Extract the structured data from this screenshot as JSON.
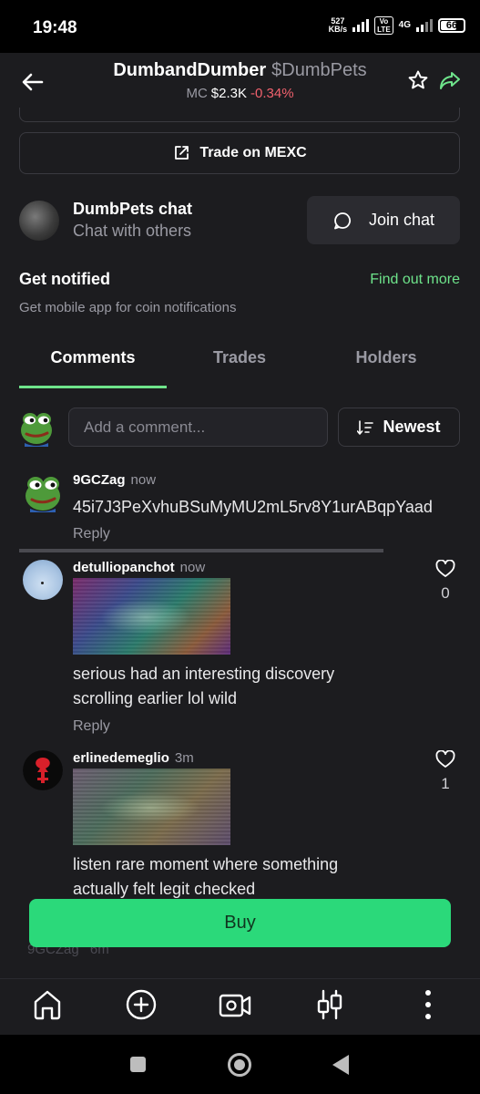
{
  "status_bar": {
    "time": "19:48",
    "net_speed_value": "527",
    "net_speed_unit": "KB/s",
    "volte_top": "Vo",
    "volte_bottom": "LTE",
    "network": "4G",
    "battery": "66"
  },
  "header": {
    "coin_name": "DumbandDumber",
    "ticker": "$DumbPets",
    "mc_label": "MC",
    "mc_value": "$2.3K",
    "mc_change": "-0.34%"
  },
  "trade_button": {
    "label": "Trade on MEXC"
  },
  "chat": {
    "title": "DumbPets chat",
    "subtitle": "Chat with others",
    "join_label": "Join chat"
  },
  "notifications": {
    "title": "Get notified",
    "link": "Find out more",
    "subtitle": "Get mobile app for coin notifications"
  },
  "tabs": [
    {
      "label": "Comments",
      "active": true
    },
    {
      "label": "Trades",
      "active": false
    },
    {
      "label": "Holders",
      "active": false
    }
  ],
  "composer": {
    "placeholder": "Add a comment...",
    "sort_label": "Newest"
  },
  "comments": [
    {
      "user": "9GCZag",
      "time": "now",
      "text": "45i7J3PeXvhuBSuMyMU2mL5rv8Y1urABqpYaad",
      "reply": "Reply"
    },
    {
      "user": "detulliopanchot",
      "time": "now",
      "text_line1": "serious had an interesting discovery",
      "text_line2": "scrolling earlier lol wild",
      "reply": "Reply",
      "likes": "0"
    },
    {
      "user": "erlinedemeglio",
      "time": "3m",
      "text_line1": "listen rare moment where something",
      "text_line2": "actually felt legit checked",
      "likes": "1"
    }
  ],
  "ghost_row": {
    "user": "9GCZag",
    "time": "6m"
  },
  "buy_button": {
    "label": "Buy"
  },
  "colors": {
    "accent_green": "#6ee48b",
    "buy_green": "#2bd97a",
    "negative_red": "#f0616d",
    "background": "#1c1c1f"
  },
  "icons": [
    "back-arrow-icon",
    "star-icon",
    "share-icon",
    "external-link-icon",
    "chat-bubble-icon",
    "sort-icon",
    "heart-icon",
    "home-icon",
    "plus-circle-icon",
    "video-icon",
    "candlestick-icon",
    "more-vertical-icon"
  ]
}
